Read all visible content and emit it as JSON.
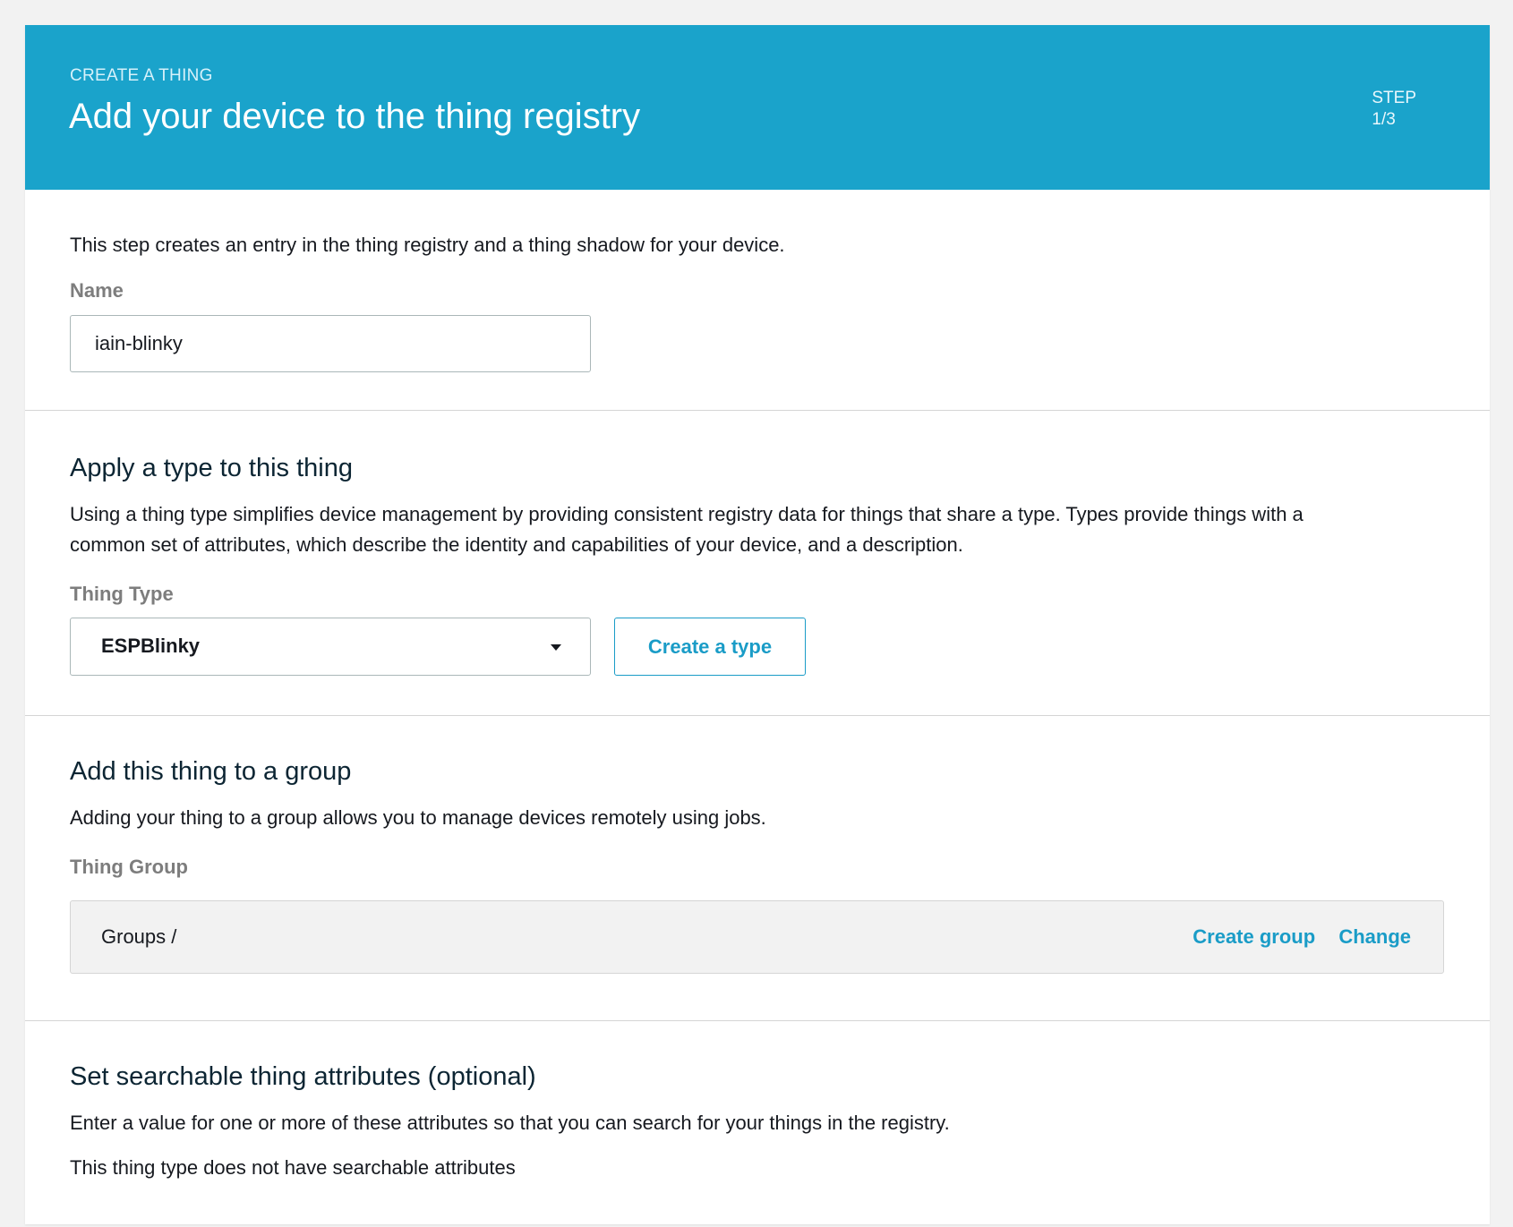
{
  "header": {
    "eyebrow": "CREATE A THING",
    "title": "Add your device to the thing registry",
    "step_label": "STEP",
    "step_value": "1/3",
    "background_color": "#1aa3cb"
  },
  "registry": {
    "description": "This step creates an entry in the thing registry and a thing shadow for your device.",
    "name_label": "Name",
    "name_value": "iain-blinky"
  },
  "type_section": {
    "heading": "Apply a type to this thing",
    "description_line1": "Using a thing type simplifies device management by providing consistent registry data for things that share a type. Types provide things with a",
    "description_line2": "common set of attributes, which describe the identity and capabilities of your device, and a description.",
    "field_label": "Thing Type",
    "selected_value": "ESPBlinky",
    "create_button": "Create a type"
  },
  "group_section": {
    "heading": "Add this thing to a group",
    "description": "Adding your thing to a group allows you to manage devices remotely using jobs.",
    "field_label": "Thing Group",
    "path": "Groups /",
    "create_link": "Create group",
    "change_link": "Change"
  },
  "attributes_section": {
    "heading": "Set searchable thing attributes (optional)",
    "description": "Enter a value for one or more of these attributes so that you can search for your things in the registry.",
    "empty_message": "This thing type does not have searchable attributes"
  },
  "colors": {
    "accent": "#1a9cc7",
    "page_background": "#f2f2f2"
  }
}
